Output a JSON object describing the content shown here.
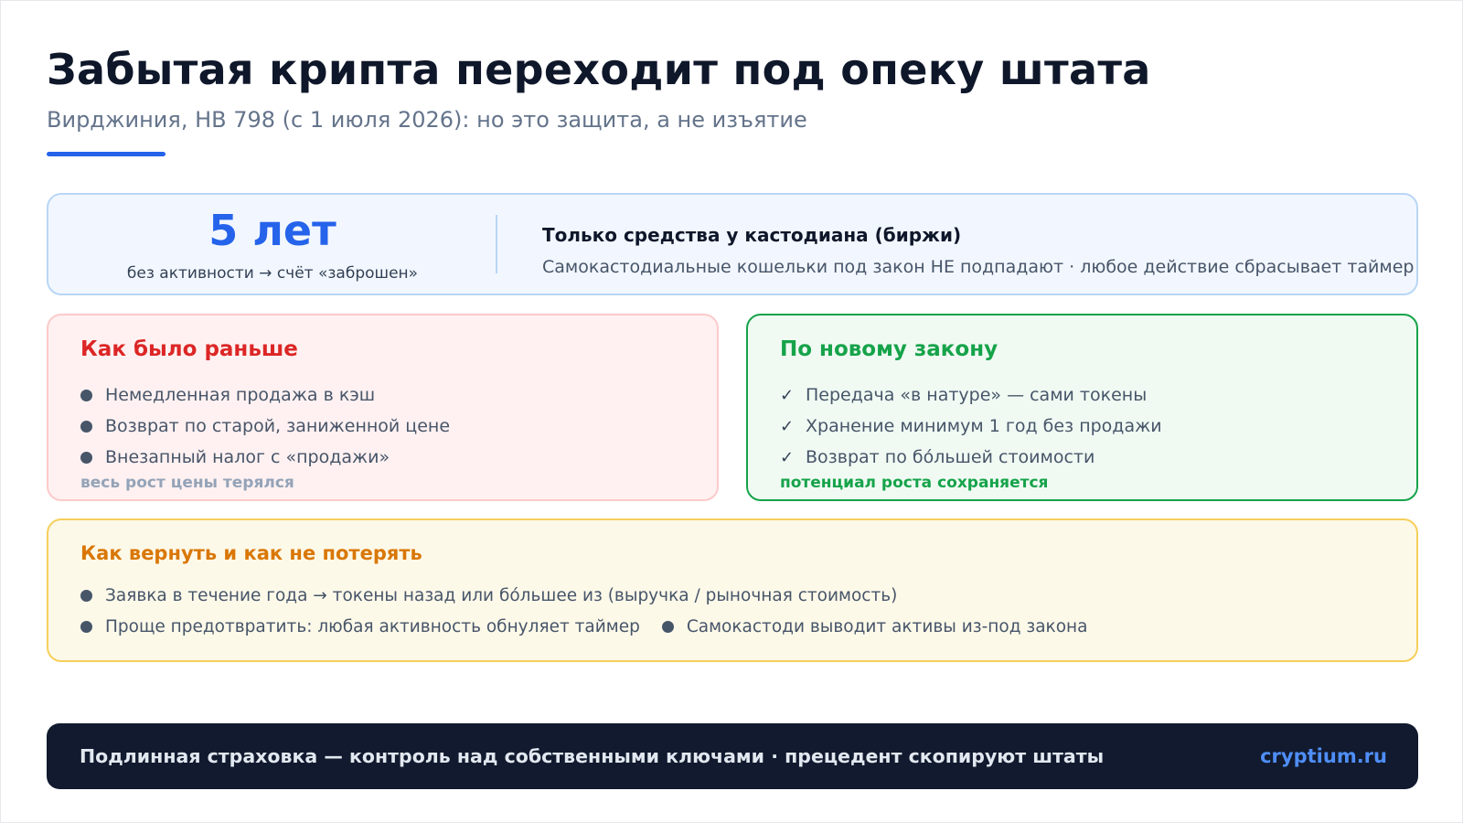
{
  "header": {
    "title": "Забытая крипта переходит под опеку штата",
    "subtitle": "Вирджиния, HB 798 (с 1 июля 2026): но это защита, а не изъятие"
  },
  "stat": {
    "number": "5 лет",
    "caption": "без активности → счёт «заброшен»",
    "right_title": "Только средства у кастодиана (биржи)",
    "right_text": "Самокастодиальные кошельки под закон НЕ подпадают · любое действие сбрасывает таймер"
  },
  "old_law": {
    "title": "Как было раньше",
    "items": [
      "Немедленная продажа в кэш",
      "Возврат по старой, заниженной цене",
      "Внезапный налог с «продажи»"
    ],
    "footer": "весь рост цены терялся"
  },
  "new_law": {
    "title": "По новому закону",
    "check_glyph": "✓",
    "items": [
      "Передача «в натуре» — сами токены",
      "Хранение минимум 1 год без продажи",
      "Возврат по бóльшей стоимости"
    ],
    "footer": "потенциал роста сохраняется"
  },
  "how_to": {
    "title": "Как вернуть и как не потерять",
    "items": [
      "Заявка в течение года → токены назад или бóльшее из (выручка / рыночная стоимость)",
      "Проще предотвратить: любая активность обнуляет таймер",
      "Самокастоди выводит активы из-под закона"
    ]
  },
  "footer": {
    "text": "Подлинная страховка — контроль над собственными ключами · прецедент скопируют штаты",
    "brand": "cryptium.ru"
  },
  "colors": {
    "accent_blue": "#2563eb",
    "old_red": "#dc2626",
    "new_green": "#16a34a",
    "how_orange": "#d97706",
    "footer_bg": "#111a2e"
  }
}
